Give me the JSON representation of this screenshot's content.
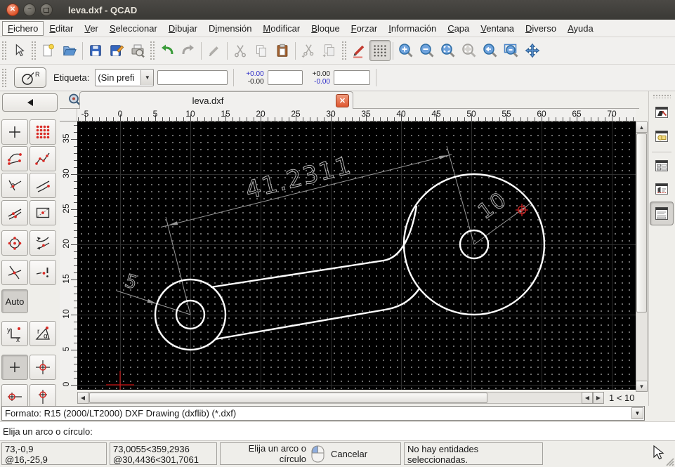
{
  "titlebar": {
    "title": "leva.dxf - QCAD"
  },
  "menubar": {
    "items": [
      {
        "pre": "",
        "mn": "F",
        "post": "ichero"
      },
      {
        "pre": "",
        "mn": "E",
        "post": "ditar"
      },
      {
        "pre": "",
        "mn": "V",
        "post": "er"
      },
      {
        "pre": "",
        "mn": "S",
        "post": "eleccionar"
      },
      {
        "pre": "",
        "mn": "D",
        "post": "ibujar"
      },
      {
        "pre": "D",
        "mn": "i",
        "post": "mensión"
      },
      {
        "pre": "",
        "mn": "M",
        "post": "odificar"
      },
      {
        "pre": "",
        "mn": "B",
        "post": "loque"
      },
      {
        "pre": "",
        "mn": "F",
        "post": "orzar"
      },
      {
        "pre": "",
        "mn": "I",
        "post": "nformación"
      },
      {
        "pre": "",
        "mn": "C",
        "post": "apa"
      },
      {
        "pre": "",
        "mn": "V",
        "post": "entana"
      },
      {
        "pre": "",
        "mn": "D",
        "post": "iverso"
      },
      {
        "pre": "",
        "mn": "A",
        "post": "yuda"
      }
    ]
  },
  "icons": {
    "toolbar": [
      "pointer",
      "new-file",
      "open-file",
      "save",
      "save-as",
      "print-preview",
      "undo",
      "redo",
      "eraser",
      "cut",
      "copy",
      "paste",
      "cut-with-reference",
      "copy-with-reference",
      "draw-pencil",
      "grid-toggle",
      "zoom-in",
      "zoom-out",
      "zoom-auto",
      "zoom-selection",
      "zoom-previous",
      "zoom-window",
      "pan"
    ],
    "snap": [
      "free",
      "grid",
      "endpoints",
      "on-entity",
      "perpendicular",
      "distance",
      "middle",
      "reference",
      "center",
      "tangent",
      "intersection",
      "intersection-manual"
    ],
    "dock": [
      "layer-list",
      "block-list",
      "library-browser",
      "command-line",
      "property-editor"
    ]
  },
  "options_toolbar": {
    "tool_icon_letter": "R",
    "label": "Etiqueta:",
    "prefix_value": "(Sin prefi",
    "input1": "",
    "tol1_plus": "+0.00",
    "tol1_minus": "-0.00",
    "input2": "",
    "tol2_plus": "+0.00",
    "tol2_minus": "-0.00",
    "input3": ""
  },
  "tabbar": {
    "active_tab": "leva.dxf"
  },
  "rulers": {
    "h": [
      "-5",
      "0",
      "5",
      "10",
      "15",
      "20",
      "25",
      "30",
      "35",
      "40",
      "45",
      "50",
      "55",
      "60",
      "65",
      "70"
    ],
    "v": [
      "35",
      "30",
      "25",
      "20",
      "15",
      "10",
      "5",
      "0"
    ]
  },
  "snap": {
    "auto": "Auto",
    "x": "x",
    "y": "y",
    "r": "r",
    "alpha": "α"
  },
  "canvas": {
    "dim_aligned": "41.2311",
    "dim_radius_large": "10",
    "dim_radius_small": "5",
    "entity_color": "#ffffff",
    "dim_color": "#9a9a9a",
    "snap_marker_color": "#cc2222",
    "bg": "#000000"
  },
  "scroll": {
    "zoom_indicator": "1 < 10"
  },
  "format_row": {
    "value": "Formato: R15 (2000/LT2000) DXF Drawing (dxflib) (*.dxf)"
  },
  "command_line": {
    "prompt": "Elija un arco o círculo:"
  },
  "statusbar": {
    "abs": "73,-0,9",
    "rel": "@16,-25,9",
    "abs_polar": "73,0055<359,2936",
    "rel_polar": "@30,4436<301,7061",
    "hint1": "Elija un arco o",
    "hint2": "círculo",
    "cancel": "Cancelar",
    "sel1": "No hay entidades",
    "sel2": "seleccionadas."
  }
}
